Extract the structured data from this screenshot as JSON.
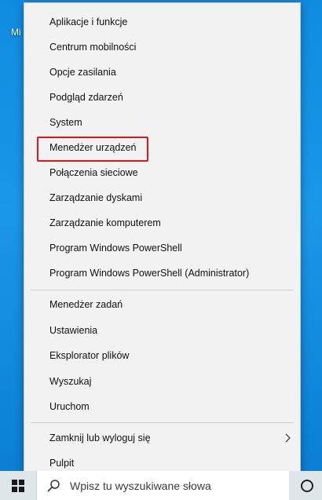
{
  "desktop": {
    "label": "Mi"
  },
  "menu": {
    "groups": [
      [
        "Aplikacje i funkcje",
        "Centrum mobilności",
        "Opcje zasilania",
        "Podgląd zdarzeń",
        "System",
        "Menedżer urządzeń",
        "Połączenia sieciowe",
        "Zarządzanie dyskami",
        "Zarządzanie komputerem",
        "Program Windows PowerShell",
        "Program Windows PowerShell (Administrator)"
      ],
      [
        "Menedżer zadań",
        "Ustawienia",
        "Eksplorator plików",
        "Wyszukaj",
        "Uruchom"
      ],
      [
        "Zamknij lub wyloguj się",
        "Pulpit"
      ]
    ],
    "highlighted_item": "Menedżer urządzeń",
    "highlight_color": "#e01717",
    "submenu_item": "Zamknij lub wyloguj się"
  },
  "taskbar": {
    "search_placeholder": "Wpisz tu wyszukiwane słowa",
    "start_icon": "windows-logo-icon",
    "search_icon": "search-icon",
    "cortana_icon": "cortana-circle-icon"
  }
}
